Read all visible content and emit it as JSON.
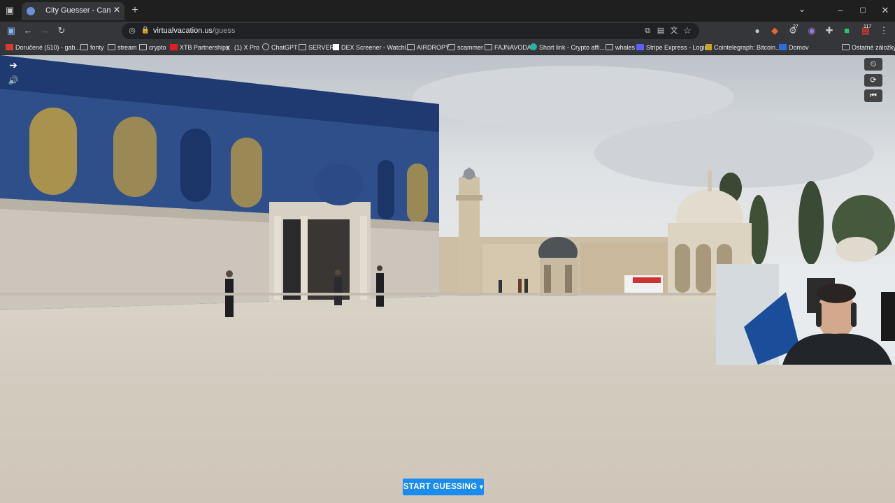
{
  "tab": {
    "title": "City Guesser - Can you guess",
    "close": "✕"
  },
  "window_controls": {
    "minimize": "–",
    "maximize": "▢",
    "close": "✕",
    "tabs_menu": "⌄"
  },
  "address": {
    "host": "virtualvacation.us",
    "path": "/guess"
  },
  "bookmarks": [
    {
      "label": "Doručené (510) - gab..."
    },
    {
      "label": "fonty"
    },
    {
      "label": "stream"
    },
    {
      "label": "crypto"
    },
    {
      "label": "XTB Partnerships"
    },
    {
      "label": "(1) X Pro"
    },
    {
      "label": "ChatGPT"
    },
    {
      "label": "SERVER"
    },
    {
      "label": "DEX Screener - Watchl..."
    },
    {
      "label": "AIRDROPY"
    },
    {
      "label": "scammer"
    },
    {
      "label": "FAJNAVODA"
    },
    {
      "label": "Short link - Crypto affi..."
    },
    {
      "label": "whales"
    },
    {
      "label": "Stripe Express - Login"
    },
    {
      "label": "Cointelegraph: Bitcoin..."
    },
    {
      "label": "Domov"
    },
    {
      "label": "Ostatné záložky"
    }
  ],
  "extensions": {
    "badge_count_1": "27",
    "badge_count_2": "117"
  },
  "game": {
    "start_button_label": "START GUESSING"
  },
  "colors": {
    "accent": "#1a8cf0",
    "toolbar": "#35363a",
    "tabbar": "#1f1f1f"
  }
}
